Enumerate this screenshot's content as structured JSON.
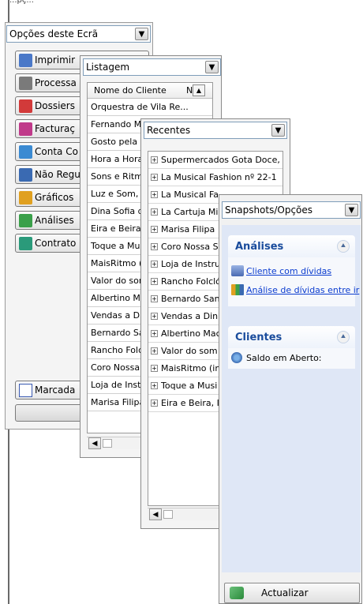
{
  "top_text": "...pç...",
  "options_panel": {
    "combo_label": "Opções deste Ecrã",
    "buttons": [
      {
        "label": "Imprimir",
        "icon": "printer-icon",
        "color": "#4a78c8"
      },
      {
        "label": "Processa",
        "icon": "process-icon",
        "color": "#7a7a7a"
      },
      {
        "label": "Dossiers",
        "icon": "folder-icon",
        "color": "#d23a3a"
      },
      {
        "label": "Facturaç",
        "icon": "invoice-icon",
        "color": "#c03a8a"
      },
      {
        "label": "Conta Co",
        "icon": "account-icon",
        "color": "#3a8ad2"
      },
      {
        "label": "Não Regu",
        "icon": "unsettled-icon",
        "color": "#3a6ab2"
      },
      {
        "label": "Gráficos",
        "icon": "chart-icon",
        "color": "#e0a020"
      },
      {
        "label": "Análises",
        "icon": "analysis-icon",
        "color": "#3aa04a"
      },
      {
        "label": "Contrato",
        "icon": "contract-icon",
        "color": "#2a9a7a"
      }
    ],
    "marked_label": "Marcada",
    "bottom_button_label": ""
  },
  "listing_panel": {
    "combo_label": "Listagem",
    "column_header": "Nome do Cliente",
    "column_header_2": "N",
    "rows": [
      "Orquestra de Vila Re...",
      "Fernando Ma",
      "Gosto pela M",
      "Hora a Hora,",
      "Sons e Ritmo",
      "Luz e Som, lo",
      "Dina Sofia de",
      "Eira e Beira,",
      "Toque a Mus",
      "MaisRitmo (ir",
      "Valor do som",
      "Albertino Ma",
      "Vendas a Dir",
      "Bernardo Sar",
      "Rancho Folcl",
      "Coro Nossa S",
      "Loja de Instr",
      "Marisa Filipa"
    ]
  },
  "recent_panel": {
    "combo_label": "Recentes",
    "rows": [
      "Supermercados Gota Doce,",
      "La Musical Fashion nº 22-1",
      "La Musical Fa",
      "La Cartuja Mi",
      "Marisa Filipa",
      "Coro Nossa S",
      "Loja de Instru",
      "Rancho Folcló",
      "Bernardo San",
      "Vendas a Din",
      "Albertino Mac",
      "Valor do som",
      "MaisRitmo (in",
      "Toque a Musi",
      "Eira e Beira, I"
    ]
  },
  "snapshots_panel": {
    "combo_label": "Snapshots/Opções",
    "sections": [
      {
        "title": "Análises",
        "items": [
          {
            "label": "Cliente com dívidas",
            "icon": "printer-icon",
            "link": true
          },
          {
            "label": "Análise de dívidas entre ir",
            "icon": "bar-chart-icon",
            "link": true
          }
        ]
      },
      {
        "title": "Clientes",
        "items": [
          {
            "label": "Saldo em Aberto:",
            "icon": "refresh-icon",
            "link": false
          }
        ]
      }
    ],
    "update_button_label": "Actualizar"
  }
}
